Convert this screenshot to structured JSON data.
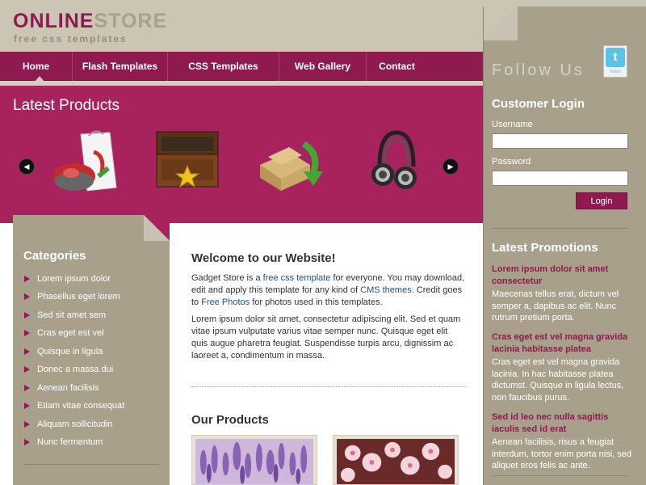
{
  "header": {
    "logo_part1": "ONLINE",
    "logo_part2": "STORE",
    "tagline": "free css templates"
  },
  "nav": {
    "items": [
      "Home",
      "Flash Templates",
      "CSS Templates",
      "Web Gallery",
      "Contact"
    ],
    "active": "Home"
  },
  "banner": {
    "title": "Latest Products",
    "prev_icon": "chevron-left-icon",
    "next_icon": "chevron-right-icon",
    "products": [
      "mouse-and-bag",
      "treasure-box",
      "box-with-arrow",
      "headphones"
    ]
  },
  "social": {
    "follow_label": "Follow Us",
    "twitter_label": "Twitter"
  },
  "login": {
    "title": "Customer Login",
    "username_label": "Username",
    "password_label": "Password",
    "username_value": "",
    "password_value": "",
    "button_label": "Login"
  },
  "promotions": {
    "title": "Latest Promotions",
    "items": [
      {
        "title": "Lorem ipsum dolor sit amet consectetur",
        "text": "Maecenas tellus erat, dictum vel semper a, dapibus ac elit. Nunc rutrum pretium porta."
      },
      {
        "title": "Cras eget est vel magna gravida lacinia habitasse platea",
        "text": "Cras eget est vel magna gravida lacinia. In hac habitasse platea dictumst. Quisque in ligula lectus, non faucibus purus."
      },
      {
        "title": "Sed id leo nec nulla sagittis iaculis sed id erat",
        "text": "Aenean facilisis, risus a feugiat interdum, tortor enim porta nisi, sed aliquet eros felis ac ante."
      }
    ]
  },
  "categories": {
    "title": "Categories",
    "items": [
      "Lorem ipsum dolor",
      "Phasellus eget lorem",
      "Sed sit amet sem",
      "Cras eget est vel",
      "Quisque in ligula",
      "Donec a massa dui",
      "Aenean facilisis",
      "Etiam vitae consequat",
      "Aliquam sollicitudin",
      "Nunc fermentum"
    ]
  },
  "main": {
    "welcome_title": "Welcome to our Website!",
    "intro": {
      "t1": "Gadget Store is a ",
      "link1": "free css template",
      "t2": " for everyone. You may download, edit and apply this template for any kind of ",
      "link2": "CMS themes",
      "t3": ". Credit goes to ",
      "link3": "Free Photos",
      "t4": " for photos used in this templates."
    },
    "paragraph2": "Lorem ipsum dolor sit amet, consectetur adipiscing elit. Sed et quam vitae ipsum vulputate varius vitae semper nunc. Quisque eget elit quis augue pharetra feugiat. Suspendisse turpis arcu, dignissim ac laoreet a, condimentum in massa.",
    "products_title": "Our Products"
  },
  "colors": {
    "brand": "#8e1a4f",
    "banner": "#a8235d",
    "sidebar": "#a8a08a",
    "header": "#cdc5b4"
  }
}
